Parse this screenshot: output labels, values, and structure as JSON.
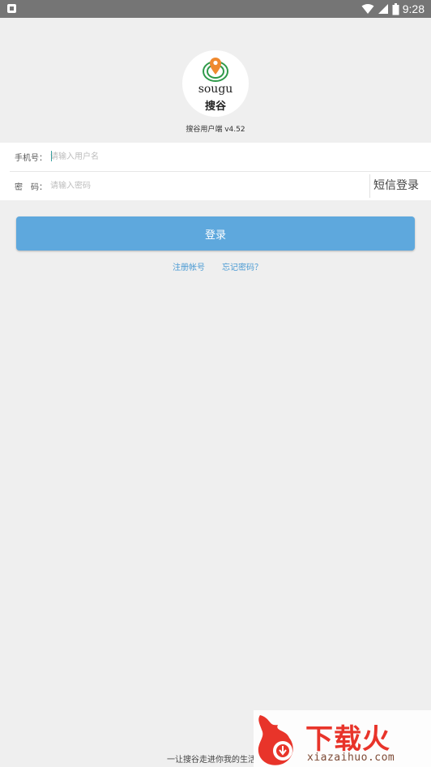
{
  "status_bar": {
    "time": "9:28",
    "icons": [
      "notification-icon",
      "wifi-icon",
      "signal-icon",
      "battery-icon"
    ]
  },
  "logo": {
    "brand_en": "sougu",
    "brand_cn": "搜谷"
  },
  "app_version": "搜谷用户端 v4.52",
  "form": {
    "phone_label": "手机号：",
    "phone_placeholder": "请输入用户名",
    "password_label": "密　码：",
    "password_placeholder": "请输入密码",
    "sms_login_label": "短信登录"
  },
  "login_button_label": "登录",
  "links": {
    "register": "注册帐号",
    "forgot_password": "忘记密码？"
  },
  "slogan": "一让搜谷走进你我的生活",
  "watermark": {
    "cn": "下载火",
    "en": "xiazaihuo.com"
  },
  "colors": {
    "background": "#efefef",
    "primary": "#5ea8dd",
    "link": "#4a9ad3",
    "logo_orange": "#ef8a2f",
    "logo_green": "#2f9a4a",
    "watermark_red": "#e8342a"
  }
}
